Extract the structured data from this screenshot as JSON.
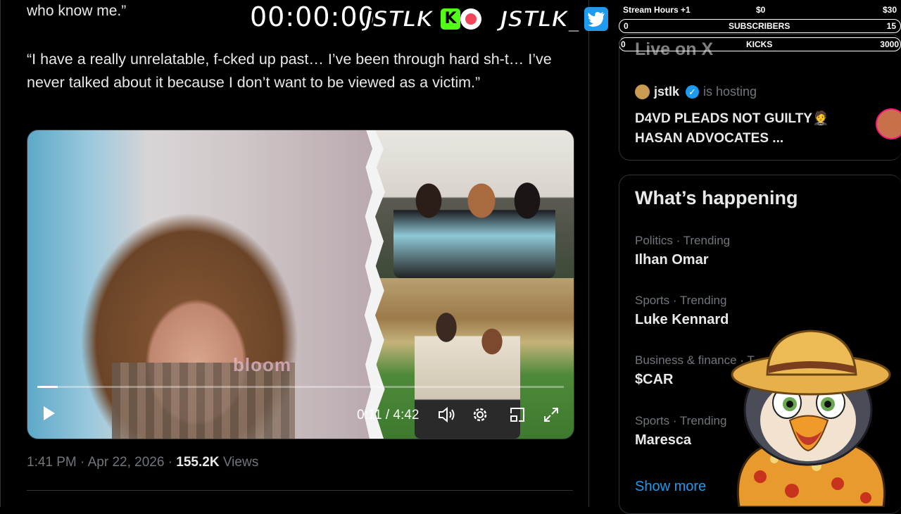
{
  "tweet": {
    "line1": "who know me.”",
    "quote": "“I have a really unrelatable, f-cked up past… I’ve been through hard sh-t… I’ve never talked about it because I don’t want to be viewed as a victim.”",
    "timestamp": "1:41 PM · Apr 22, 2026 · ",
    "views_count": "155.2K",
    "views_label": " Views"
  },
  "video": {
    "watermark": "bloom",
    "time_display": "0:11 / 4:42",
    "progress": 0.039,
    "icons": [
      "play-icon",
      "volume-icon",
      "settings-icon",
      "minimize-icon",
      "fullscreen-icon"
    ]
  },
  "overlay": {
    "timer": "00:00:00",
    "brand_kick": "JSTLK",
    "kick_badge": "K",
    "brand_twitter": "JSTLK_",
    "stream_hours_label": "Stream Hours +1",
    "stream_hours_min": "$0",
    "stream_hours_max": "$30",
    "subs_current": "0",
    "subs_label": "SUBSCRIBERS",
    "subs_goal": "15",
    "kicks_current": "0",
    "kicks_label": "KICKS",
    "kicks_goal": "3000"
  },
  "live": {
    "title": "Live on X",
    "host_name": "jstlk",
    "hosting_label": "is hosting",
    "headline": "D4VD PLEADS NOT GUILTY🤵 HASAN ADVOCATES ..."
  },
  "happening": {
    "title": "What’s happening",
    "trends": [
      {
        "context": "Politics · Trending",
        "topic": "Ilhan Omar"
      },
      {
        "context": "Sports · Trending",
        "topic": "Luke Kennard"
      },
      {
        "context": "Business & finance · T",
        "topic": "$CAR"
      },
      {
        "context": "Sports · Trending",
        "topic": "Maresca"
      }
    ],
    "show_more": "Show more"
  },
  "colors": {
    "background": "#000000",
    "text": "#e7e9ea",
    "muted": "#71767b",
    "accent": "#1d9bf0",
    "kick_green": "#53fc18",
    "border": "#2f3336"
  }
}
